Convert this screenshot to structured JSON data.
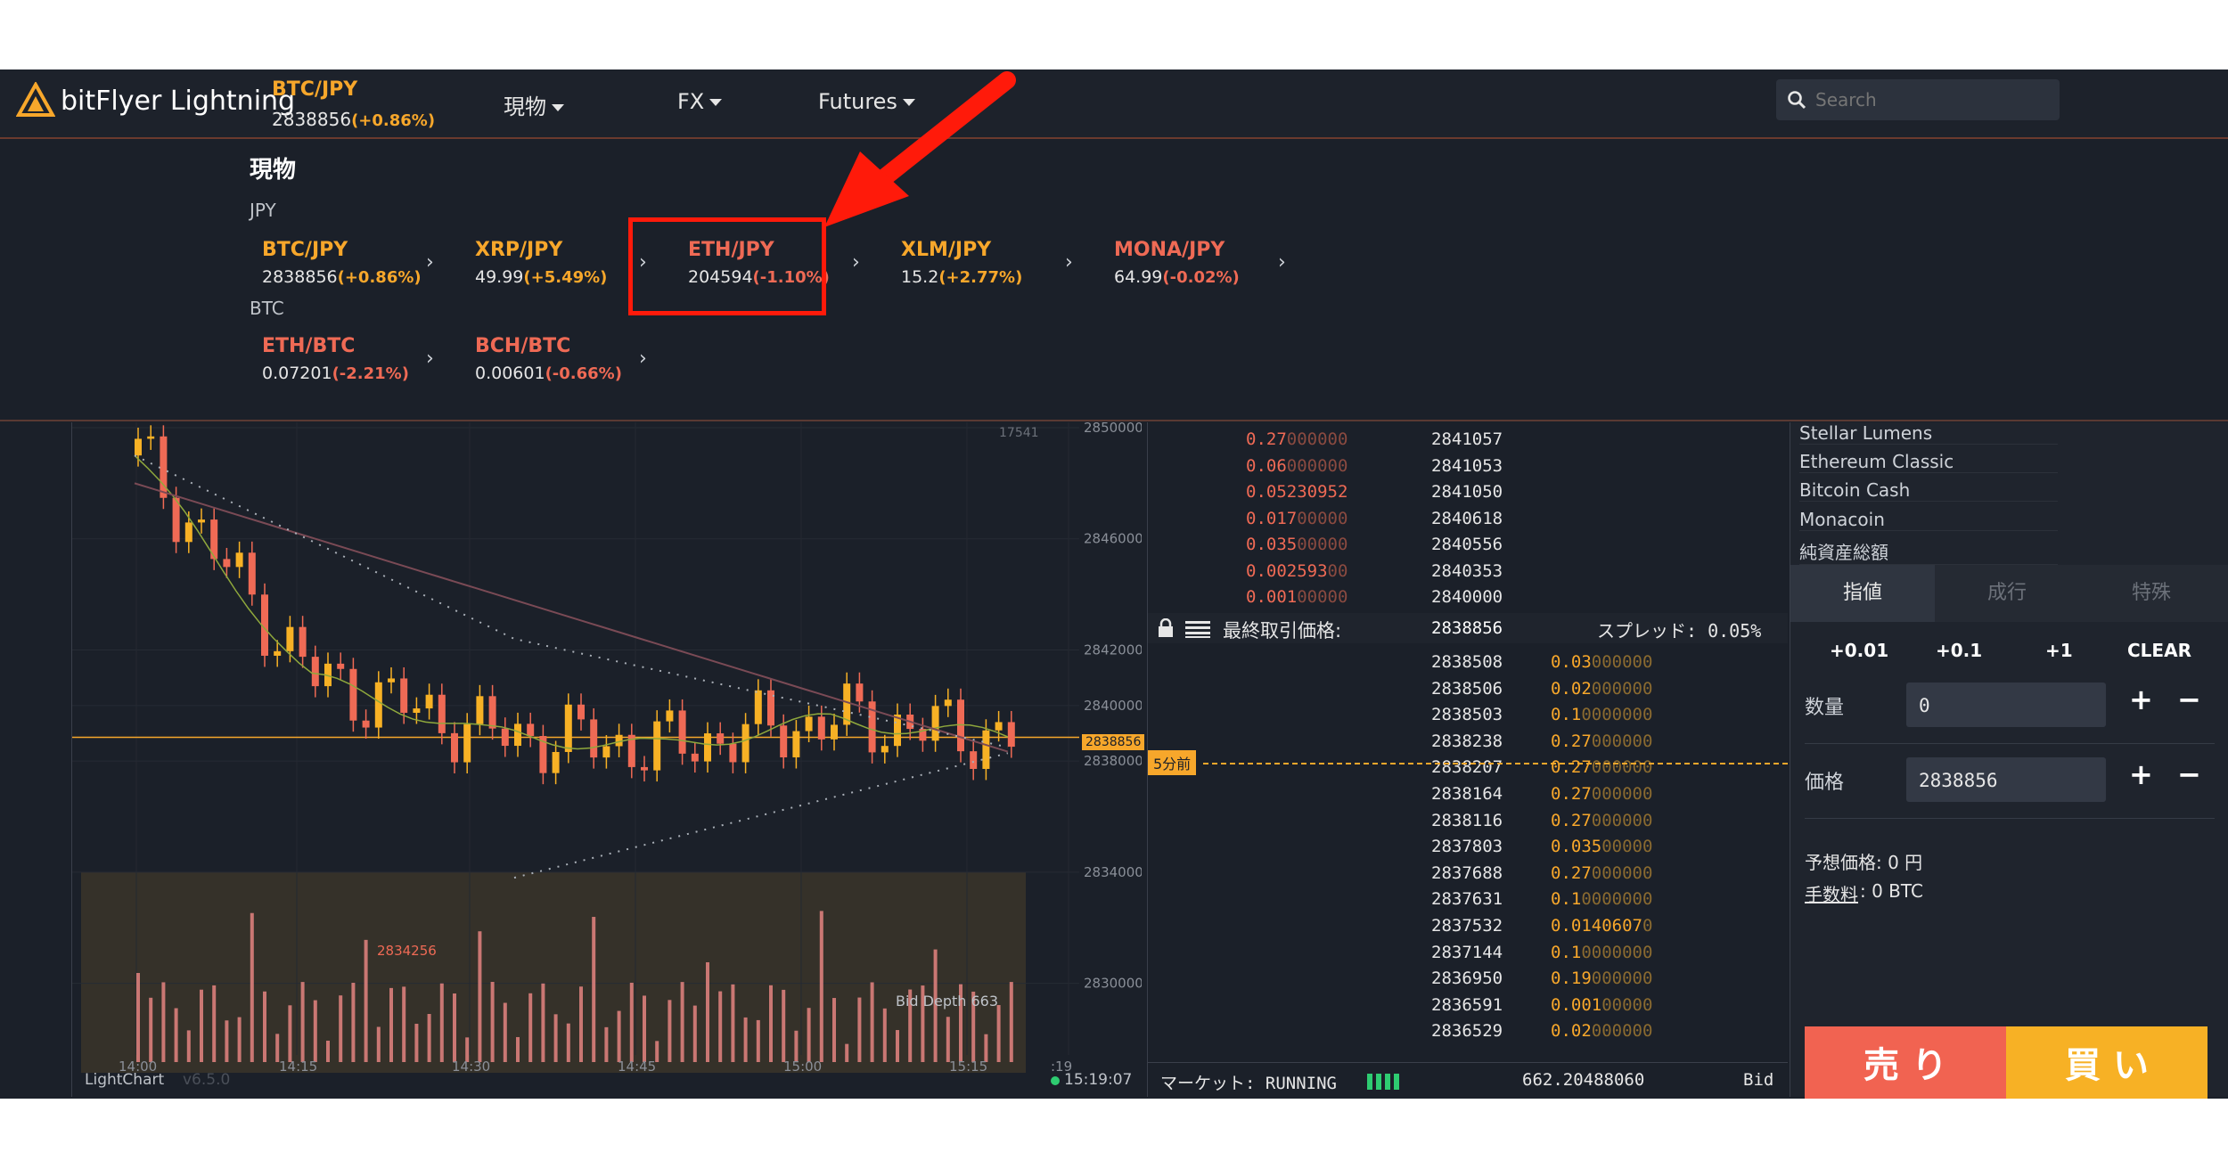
{
  "header": {
    "logo_text": "bitFlyer Lightning",
    "pair": "BTC/JPY",
    "price": "2838856",
    "change": "(+0.86%)",
    "nav": [
      "現物",
      "FX",
      "Futures"
    ],
    "search_placeholder": "Search"
  },
  "panel": {
    "title": "現物",
    "groups": [
      {
        "label": "JPY",
        "markets": [
          {
            "name": "BTC/JPY",
            "price": "2838856",
            "change": "(+0.86%)"
          },
          {
            "name": "XRP/JPY",
            "price": "49.99",
            "change": "(+5.49%)"
          },
          {
            "name": "ETH/JPY",
            "price": "204594",
            "change": "(-1.10%)"
          },
          {
            "name": "XLM/JPY",
            "price": "15.2",
            "change": "(+2.77%)"
          },
          {
            "name": "MONA/JPY",
            "price": "64.99",
            "change": "(-0.02%)"
          }
        ]
      },
      {
        "label": "BTC",
        "markets": [
          {
            "name": "ETH/BTC",
            "price": "0.07201",
            "change": "(-2.21%)"
          },
          {
            "name": "BCH/BTC",
            "price": "0.00601",
            "change": "(-0.66%)"
          }
        ]
      }
    ]
  },
  "chart": {
    "y_ticks": [
      "2850000",
      "2846000",
      "2842000",
      "2840000",
      "2838000",
      "2834000",
      "2830000"
    ],
    "x_ticks": [
      "14:00",
      "14:15",
      "14:30",
      "14:45",
      "15:00",
      "15:15",
      ":19"
    ],
    "current_price": "2838856",
    "low_label": "2834256",
    "top_label": "17541",
    "depth_label": "Bid Depth 663",
    "five_min": "5分前",
    "footer_left": "LightChart",
    "footer_version": "v6.5.0",
    "footer_time": "15:19:07"
  },
  "chart_data": {
    "type": "line",
    "title": "",
    "xlabel": "",
    "ylabel": "",
    "x": [
      "14:00",
      "14:15",
      "14:30",
      "14:45",
      "15:00",
      "15:15"
    ],
    "series": [
      {
        "values": [
          2849000,
          2841000,
          2839000,
          2838500,
          2839500,
          2838856
        ]
      }
    ],
    "ylim": [
      2828000,
      2850000
    ]
  },
  "orderbook": {
    "asks": [
      {
        "qty_a": "0.27",
        "qty_b": "000000",
        "price": "2841057"
      },
      {
        "qty_a": "0.06",
        "qty_b": "000000",
        "price": "2841053"
      },
      {
        "qty_a": "0.05230952",
        "qty_b": "",
        "price": "2841050"
      },
      {
        "qty_a": "0.017",
        "qty_b": "00000",
        "price": "2840618"
      },
      {
        "qty_a": "0.035",
        "qty_b": "00000",
        "price": "2840556"
      },
      {
        "qty_a": "0.002593",
        "qty_b": "00",
        "price": "2840353"
      },
      {
        "qty_a": "0.001",
        "qty_b": "00000",
        "price": "2840000"
      }
    ],
    "last_label": "最終取引価格:",
    "last_price": "2838856",
    "spread_label": "スプレッド: 0.05%",
    "bids": [
      {
        "price": "2838508",
        "qty_a": "0.03",
        "qty_b": "000000"
      },
      {
        "price": "2838506",
        "qty_a": "0.02",
        "qty_b": "000000"
      },
      {
        "price": "2838503",
        "qty_a": "0.1",
        "qty_b": "0000000"
      },
      {
        "price": "2838238",
        "qty_a": "0.27",
        "qty_b": "000000"
      },
      {
        "price": "2838207",
        "qty_a": "0.27",
        "qty_b": "000000"
      },
      {
        "price": "2838164",
        "qty_a": "0.27",
        "qty_b": "000000"
      },
      {
        "price": "2838116",
        "qty_a": "0.27",
        "qty_b": "000000"
      },
      {
        "price": "2837803",
        "qty_a": "0.035",
        "qty_b": "00000"
      },
      {
        "price": "2837688",
        "qty_a": "0.27",
        "qty_b": "000000"
      },
      {
        "price": "2837631",
        "qty_a": "0.1",
        "qty_b": "0000000"
      },
      {
        "price": "2837532",
        "qty_a": "0.0140607",
        "qty_b": "0"
      },
      {
        "price": "2837144",
        "qty_a": "0.1",
        "qty_b": "0000000"
      },
      {
        "price": "2836950",
        "qty_a": "0.19",
        "qty_b": "000000"
      },
      {
        "price": "2836591",
        "qty_a": "0.001",
        "qty_b": "00000"
      },
      {
        "price": "2836529",
        "qty_a": "0.02",
        "qty_b": "000000"
      }
    ],
    "market_label": "マーケット: RUNNING",
    "total": "662.20488060",
    "side": "Bid"
  },
  "order_panel": {
    "list": [
      "Stellar Lumens",
      "Ethereum Classic",
      "Bitcoin Cash",
      "Monacoin",
      "純資産総額"
    ],
    "tabs": [
      "指値",
      "成行",
      "特殊"
    ],
    "increments": [
      "+0.01",
      "+0.1",
      "+1",
      "CLEAR"
    ],
    "qty_label": "数量",
    "qty_value": "0",
    "price_label": "価格",
    "price_value": "2838856",
    "estimate": "予想価格: 0 円",
    "fee_label": "手数料",
    "fee_value": ": 0 BTC",
    "sell": "売 り",
    "buy": "買 い"
  }
}
